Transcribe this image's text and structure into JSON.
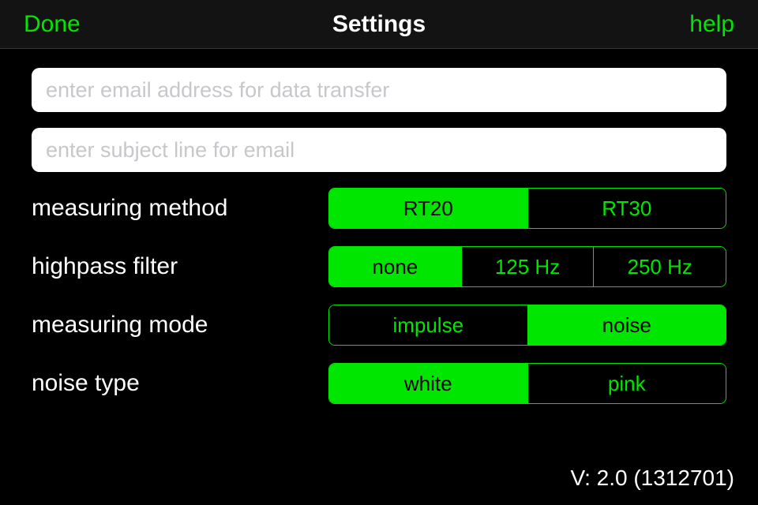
{
  "navbar": {
    "done": "Done",
    "title": "Settings",
    "help": "help"
  },
  "inputs": {
    "email_placeholder": "enter email address for data transfer",
    "email_value": "",
    "subject_placeholder": "enter subject line for email",
    "subject_value": ""
  },
  "settings": {
    "measuring_method": {
      "label": "measuring method",
      "options": [
        "RT20",
        "RT30"
      ],
      "selected": "RT20"
    },
    "highpass_filter": {
      "label": "highpass filter",
      "options": [
        "none",
        "125 Hz",
        "250 Hz"
      ],
      "selected": "none"
    },
    "measuring_mode": {
      "label": "measuring mode",
      "options": [
        "impulse",
        "noise"
      ],
      "selected": "noise"
    },
    "noise_type": {
      "label": "noise type",
      "options": [
        "white",
        "pink"
      ],
      "selected": "white"
    }
  },
  "version": "V: 2.0 (1312701)"
}
